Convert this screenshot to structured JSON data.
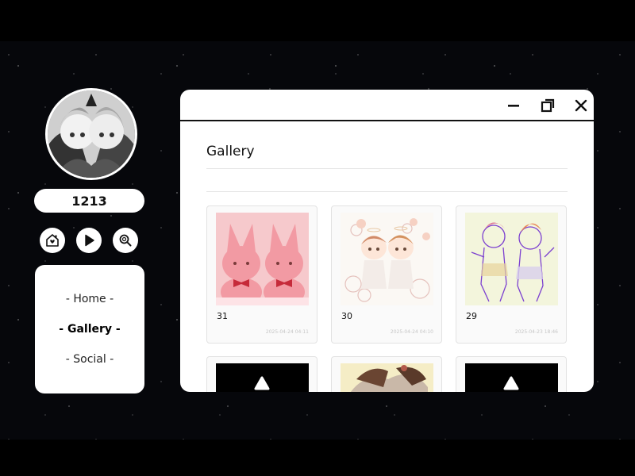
{
  "profile": {
    "username": "1213"
  },
  "icons": {
    "home": "home-heart-icon",
    "play": "play-icon",
    "search": "search-icon"
  },
  "nav": {
    "items": [
      {
        "label": "- Home -",
        "active": false
      },
      {
        "label": "- Gallery -",
        "active": true
      },
      {
        "label": "- Social -",
        "active": false
      }
    ]
  },
  "window": {
    "controls": [
      "minimize-icon",
      "restore-icon",
      "close-icon"
    ],
    "title": "Gallery"
  },
  "gallery": {
    "items": [
      {
        "number": "31",
        "date": "2025-04-24 04:11"
      },
      {
        "number": "30",
        "date": "2025-04-24 04:10"
      },
      {
        "number": "29",
        "date": "2025-04-23 18:46"
      }
    ]
  },
  "colors": {
    "background": "#000000",
    "panel": "#ffffff",
    "text": "#111111"
  }
}
